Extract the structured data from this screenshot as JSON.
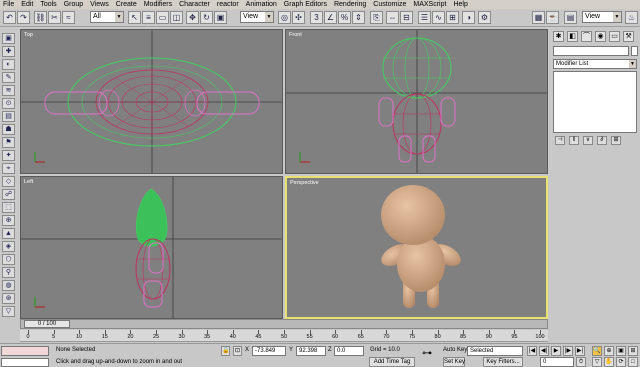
{
  "menu": [
    "File",
    "Edit",
    "Tools",
    "Group",
    "Views",
    "Create",
    "Modifiers",
    "Character",
    "reactor",
    "Animation",
    "Graph Editors",
    "Rendering",
    "Customize",
    "MAXScript",
    "Help"
  ],
  "toolbar": {
    "selection_filter": "All",
    "ref_coord": "View",
    "named_sel": "View"
  },
  "viewports": {
    "top": "Top",
    "front": "Front",
    "left": "Left",
    "perspective": "Perspective"
  },
  "command_panel": {
    "modifier_list": "Modifier List"
  },
  "timeline": {
    "slider": "0 / 100",
    "ticks": [
      "0",
      "5",
      "10",
      "15",
      "20",
      "25",
      "30",
      "35",
      "40",
      "45",
      "50",
      "55",
      "60",
      "65",
      "70",
      "75",
      "80",
      "85",
      "90",
      "95",
      "100"
    ]
  },
  "status": {
    "selection": "None Selected",
    "prompt": "Click and drag up-and-down to zoom in and out",
    "x_label": "X",
    "x_value": "-73.849",
    "y_label": "Y",
    "y_value": "92.398",
    "z_label": "Z",
    "z_value": "0.0",
    "grid": "Grid = 10.0",
    "add_time_tag": "Add Time Tag",
    "auto_key": "Auto Key",
    "set_key": "Set Key",
    "key_mode": "Selected",
    "key_filters": "Key Filters...",
    "frame": "0"
  },
  "colors": {
    "wire_pink": "#e070c8",
    "wire_green": "#40d060",
    "wire_red": "#c03060",
    "skin": "#c8a080",
    "active_border": "#e8e070"
  }
}
